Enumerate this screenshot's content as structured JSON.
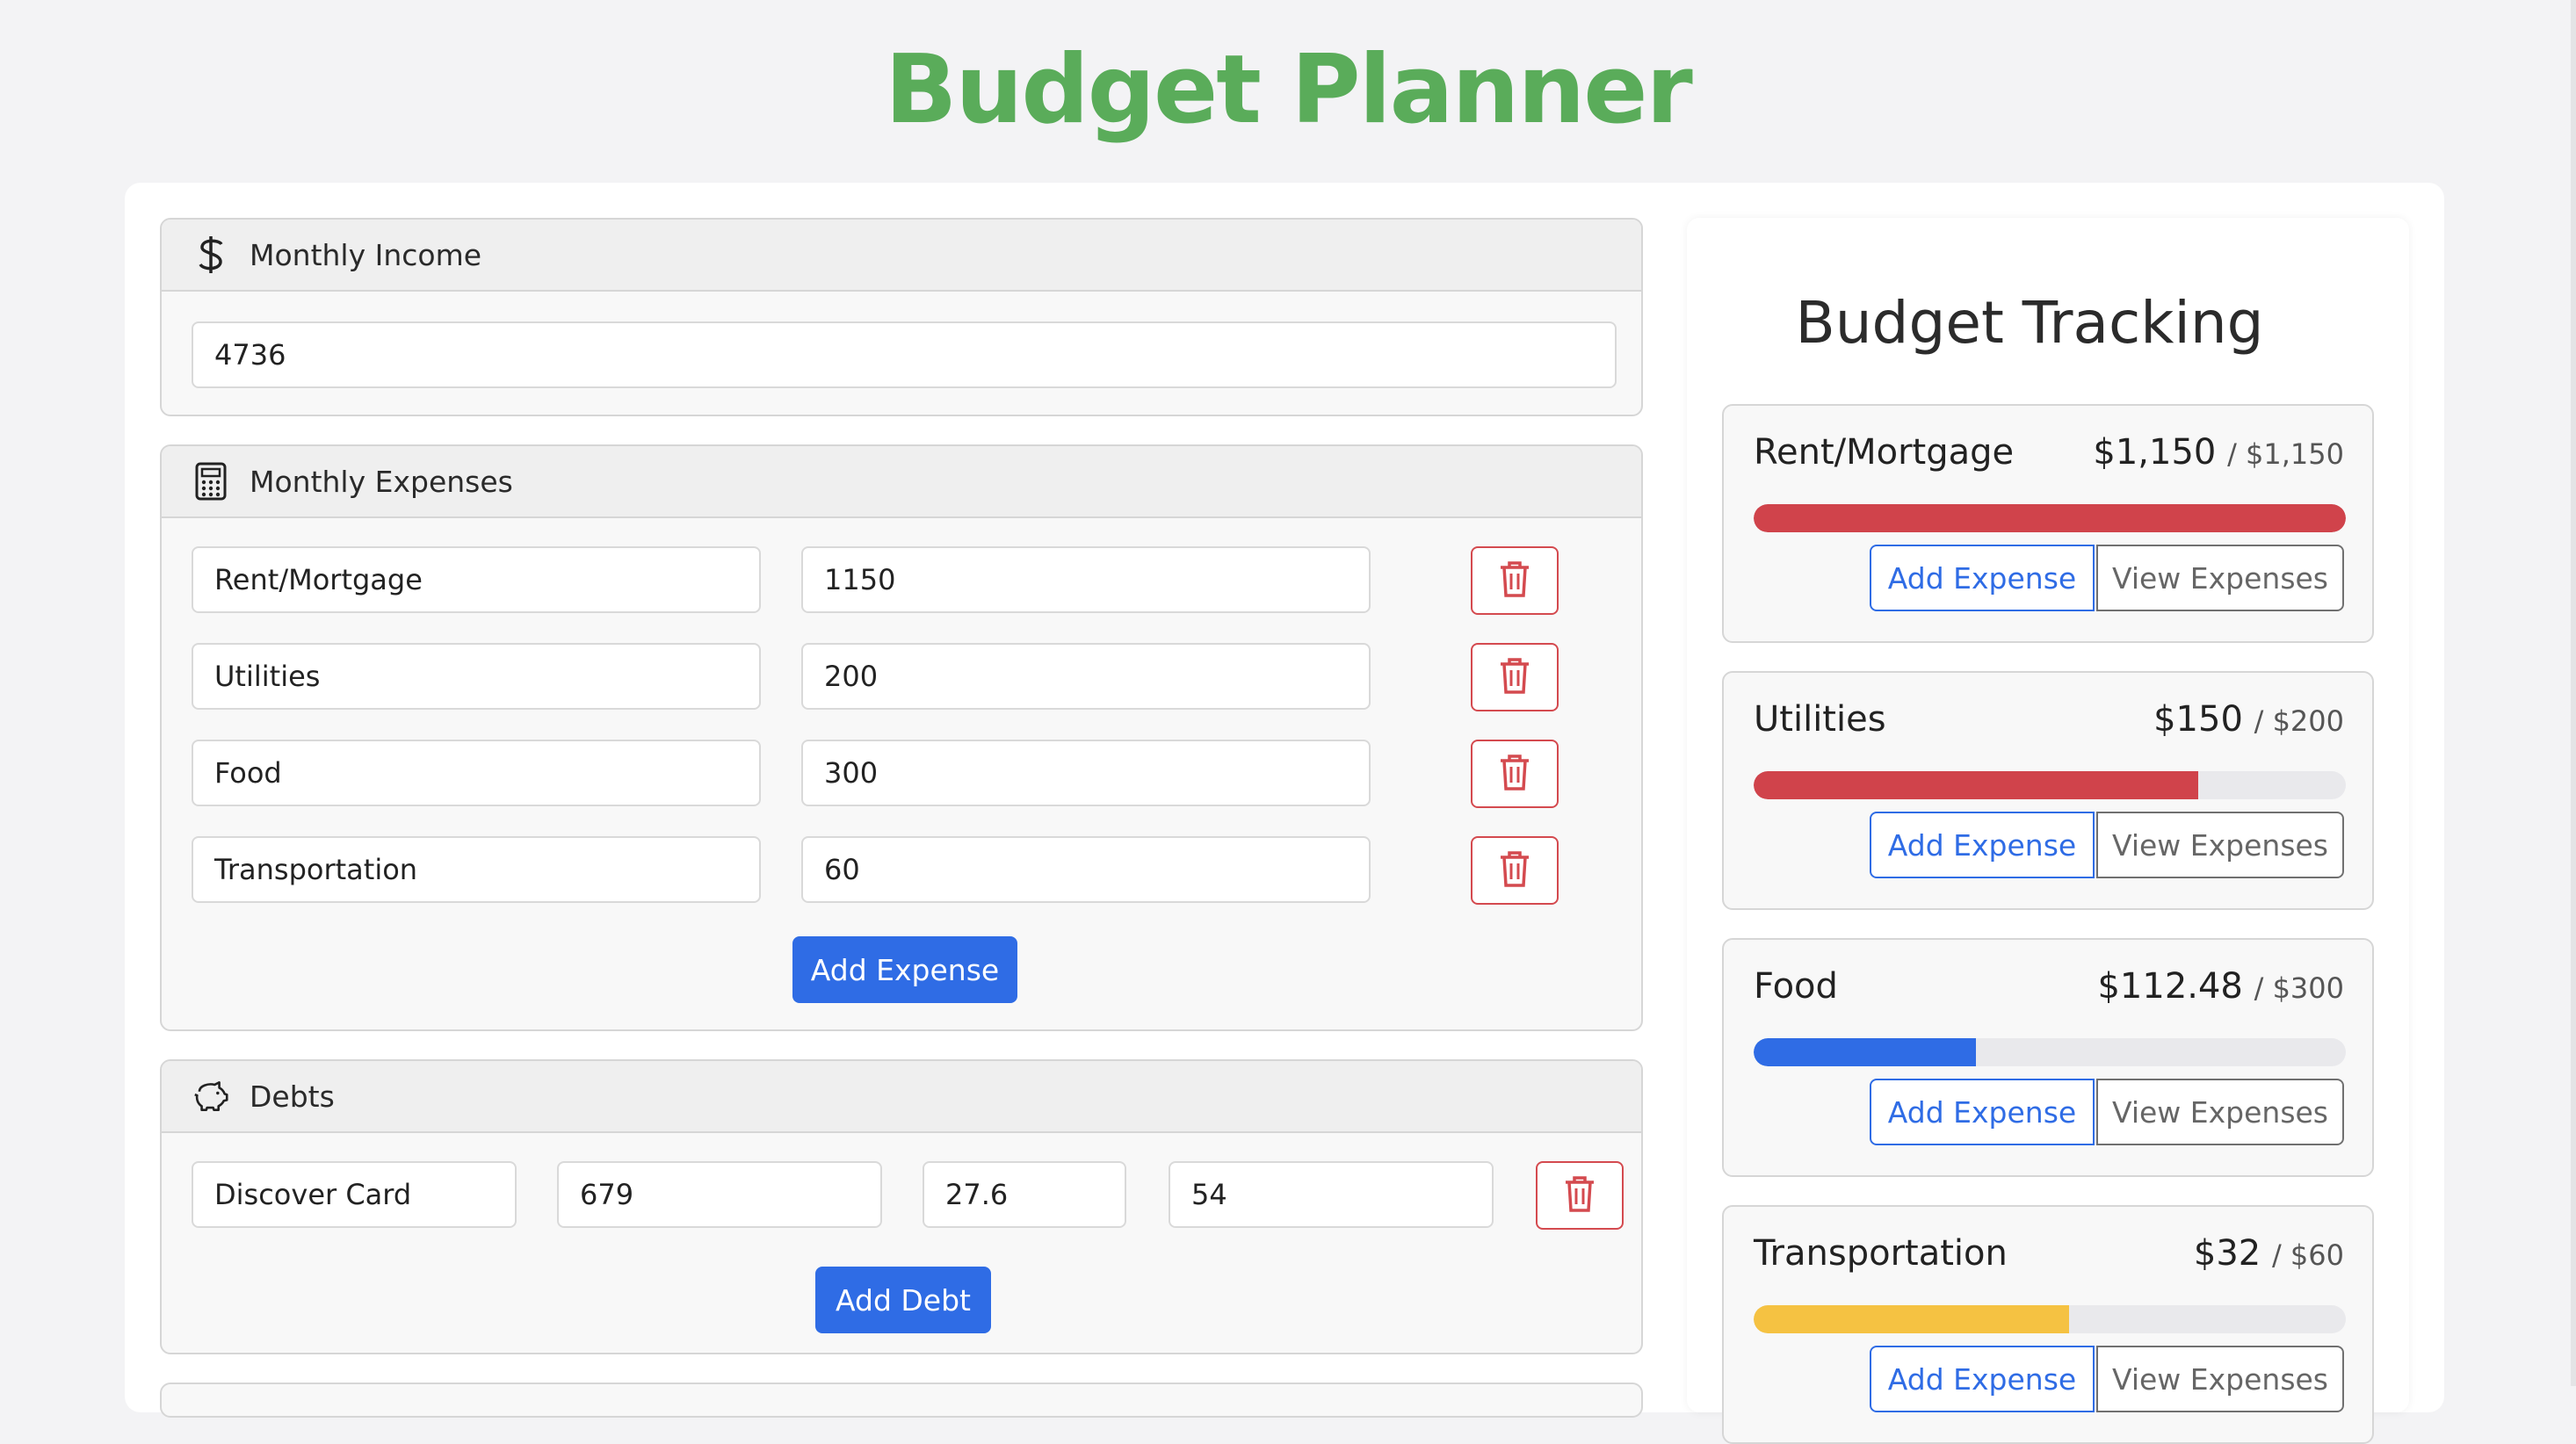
{
  "app_title": "Budget Planner",
  "income": {
    "header": "Monthly Income",
    "icon": "dollar-icon",
    "value": "4736"
  },
  "expenses": {
    "header": "Monthly Expenses",
    "icon": "calculator-icon",
    "items": [
      {
        "name": "Rent/Mortgage",
        "amount": "1150"
      },
      {
        "name": "Utilities",
        "amount": "200"
      },
      {
        "name": "Food",
        "amount": "300"
      },
      {
        "name": "Transportation",
        "amount": "60"
      }
    ],
    "add_label": "Add Expense"
  },
  "debts": {
    "header": "Debts",
    "icon": "piggy-bank-icon",
    "items": [
      {
        "name": "Discover Card",
        "balance": "679",
        "rate": "27.6",
        "payment": "54"
      }
    ],
    "add_label": "Add Debt"
  },
  "tracking": {
    "title": "Budget Tracking",
    "add_label": "Add Expense",
    "view_label": "View Expenses",
    "categories": [
      {
        "name": "Rent/Mortgage",
        "spent": "$1,150",
        "budget": "/ $1,150",
        "progress": 1.0,
        "color": "#d0434b"
      },
      {
        "name": "Utilities",
        "spent": "$150",
        "budget": "/ $200",
        "progress": 0.75,
        "color": "#d0434b"
      },
      {
        "name": "Food",
        "spent": "$112.48",
        "budget": "/ $300",
        "progress": 0.375,
        "color": "#2f6ce5"
      },
      {
        "name": "Transportation",
        "spent": "$32",
        "budget": "/ $60",
        "progress": 0.533,
        "color": "#f5c242"
      }
    ]
  },
  "colors": {
    "title": "#5aac5a",
    "primary": "#2f6ce5",
    "danger": "#d0434b",
    "warning": "#f5c242"
  }
}
